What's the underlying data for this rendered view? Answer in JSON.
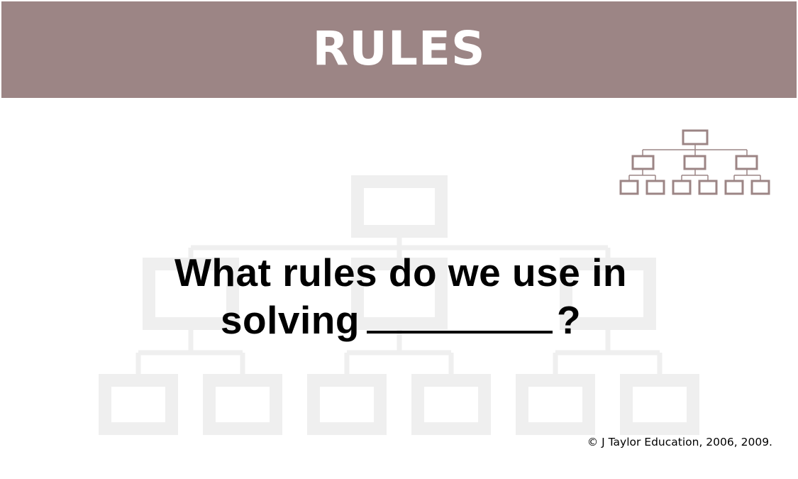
{
  "header": {
    "title": "RULES",
    "background": "#9c8585"
  },
  "question": {
    "line1": "What rules do we use in",
    "line2_prefix": "solving",
    "line2_suffix": "?"
  },
  "footer": {
    "copyright": "© J Taylor Education, 2006, 2009."
  },
  "icons": {
    "corner": "hierarchy-chart-icon",
    "background": "hierarchy-chart-watermark"
  },
  "colors": {
    "icon_stroke": "#9c8585",
    "watermark": "#efefef"
  }
}
